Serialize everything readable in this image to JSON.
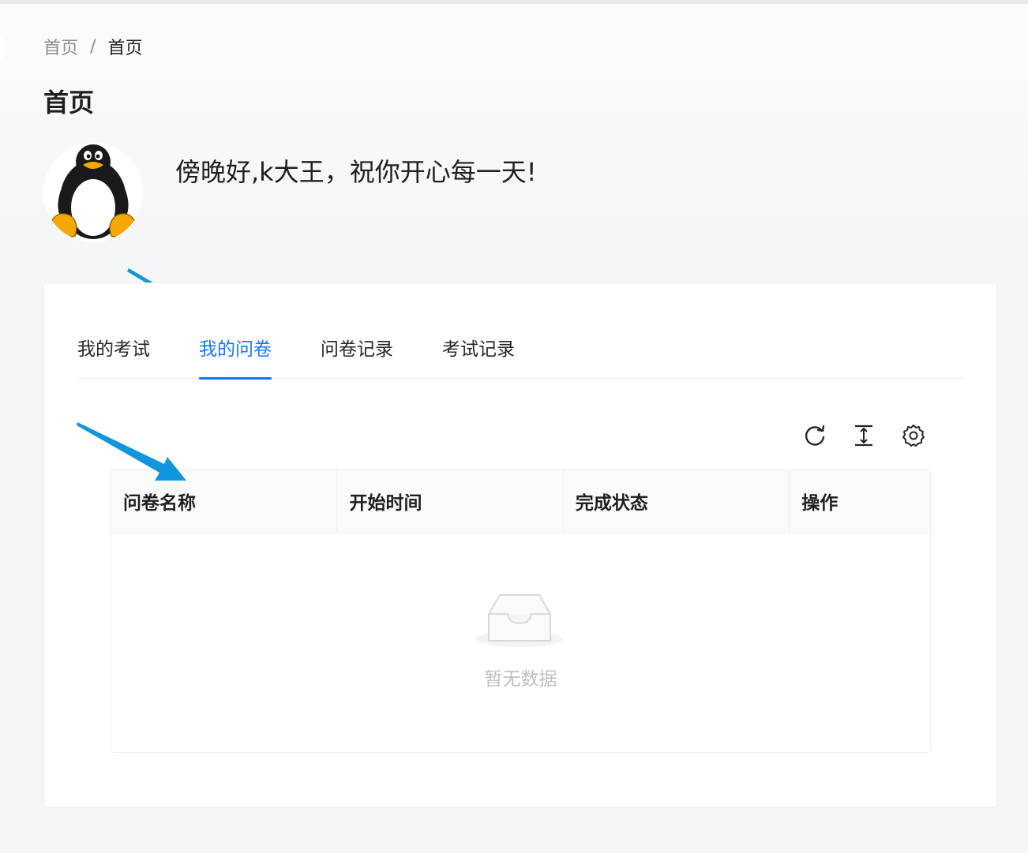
{
  "breadcrumb": {
    "home": "首页",
    "separator": "/",
    "current": "首页"
  },
  "page_title": "首页",
  "greeting": "傍晚好,k大王，祝你开心每一天!",
  "tabs": [
    {
      "label": "我的考试",
      "active": false
    },
    {
      "label": "我的问卷",
      "active": true
    },
    {
      "label": "问卷记录",
      "active": false
    },
    {
      "label": "考试记录",
      "active": false
    }
  ],
  "toolbar": {
    "icons": [
      "reload-icon",
      "column-height-icon",
      "setting-icon"
    ]
  },
  "table": {
    "columns": [
      "问卷名称",
      "开始时间",
      "完成状态",
      "操作"
    ],
    "rows": [],
    "empty_text": "暂无数据"
  },
  "colors": {
    "accent": "#1677ff",
    "annotation_arrow": "#1296db"
  }
}
